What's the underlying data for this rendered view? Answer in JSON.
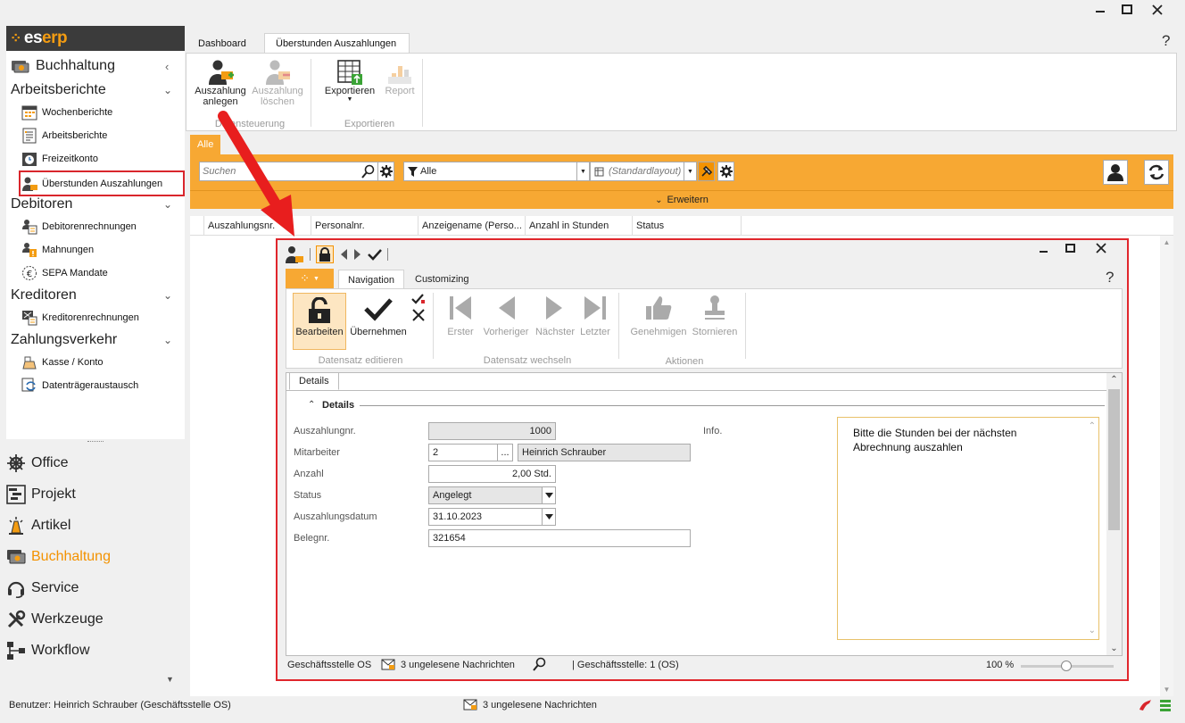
{
  "window": {
    "minimize": "—",
    "maximize": "☐",
    "close": "✕"
  },
  "help": "?",
  "logo": {
    "prefix": "es",
    "suffix": "erp"
  },
  "sidebar": {
    "header": "Buchhaltung",
    "groups": [
      {
        "label": "Arbeitsberichte",
        "items": [
          "Wochenberichte",
          "Arbeitsberichte",
          "Freizeitkonto",
          "Überstunden Auszahlungen"
        ]
      },
      {
        "label": "Debitoren",
        "items": [
          "Debitorenrechnungen",
          "Mahnungen",
          "SEPA Mandate"
        ]
      },
      {
        "label": "Kreditoren",
        "items": [
          "Kreditorenrechnungen"
        ]
      },
      {
        "label": "Zahlungsverkehr",
        "items": [
          "Kasse / Konto",
          "Datenträgeraustausch"
        ]
      }
    ]
  },
  "modules": [
    "Office",
    "Projekt",
    "Artikel",
    "Buchhaltung",
    "Service",
    "Werkzeuge",
    "Workflow"
  ],
  "tabs": [
    "Dashboard",
    "Überstunden Auszahlungen"
  ],
  "ribbon": {
    "btn1": [
      "Auszahlung",
      "anlegen"
    ],
    "btn2": [
      "Auszahlung",
      "löschen"
    ],
    "group1": "Datensteuerung",
    "btn3": "Exportieren",
    "btn4": "Report",
    "group2": "Exportieren"
  },
  "filter": {
    "alltab": "Alle",
    "search_placeholder": "Suchen",
    "filter_value": "Alle",
    "layout_value": "(Standardlayout)",
    "expand": "Erweitern"
  },
  "grid": {
    "columns": [
      "Auszahlungsnr.",
      "Personalnr.",
      "Anzeigename (Perso...",
      "Anzahl in Stunden",
      "Status"
    ]
  },
  "dialog": {
    "tabs": [
      "Navigation",
      "Customizing"
    ],
    "buttons": {
      "edit": "Bearbeiten",
      "accept": "Übernehmen",
      "first": "Erster",
      "prev": "Vorheriger",
      "next": "Nächster",
      "last": "Letzter",
      "approve": "Genehmigen",
      "cancel": "Stornieren"
    },
    "groups": {
      "g1": "Datensatz editieren",
      "g2": "Datensatz wechseln",
      "g3": "Aktionen"
    },
    "detail_tab": "Details",
    "section": "Details",
    "fields": {
      "nr_label": "Auszahlungnr.",
      "nr_value": "1000",
      "emp_label": "Mitarbeiter",
      "emp_id": "2",
      "emp_more": "...",
      "emp_name": "Heinrich Schrauber",
      "qty_label": "Anzahl",
      "qty_value": "2,00 Std.",
      "status_label": "Status",
      "status_value": "Angelegt",
      "date_label": "Auszahlungsdatum",
      "date_value": "31.10.2023",
      "beleg_label": "Belegnr.",
      "beleg_value": "321654",
      "info_label": "Info.",
      "info_text": "Bitte die Stunden bei der nächsten Abrechnung auszahlen"
    },
    "status": {
      "branch": "Geschäftsstelle OS",
      "messages": "3 ungelesene Nachrichten",
      "branch2": "| Geschäftsstelle:  1 (OS)",
      "zoom": "100 %"
    }
  },
  "statusbar": {
    "user": "Benutzer: Heinrich Schrauber (Geschäftsstelle OS)",
    "messages": "3 ungelesene Nachrichten"
  }
}
